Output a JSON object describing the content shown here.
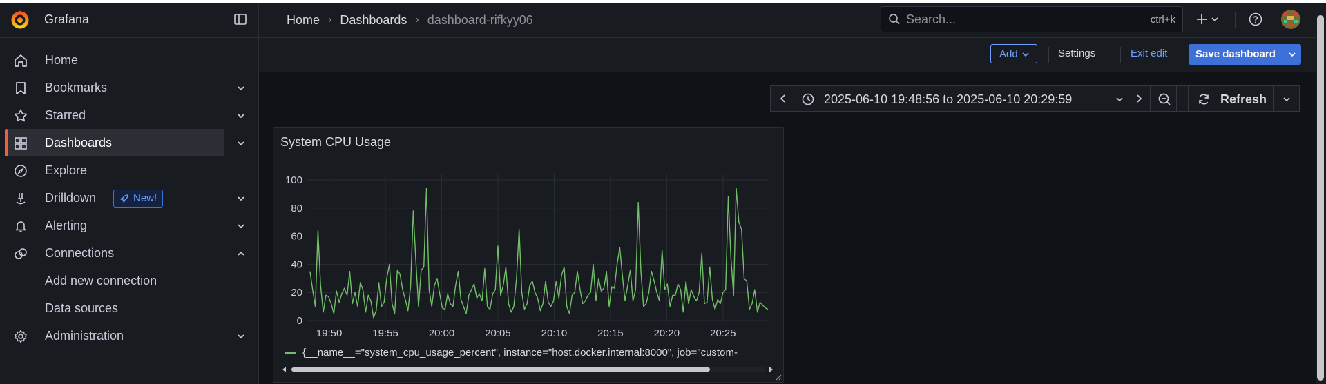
{
  "app": {
    "name": "Grafana"
  },
  "sidebar": {
    "items": [
      {
        "label": "Home",
        "icon": "home-icon",
        "chevron": ""
      },
      {
        "label": "Bookmarks",
        "icon": "bookmark-icon",
        "chevron": "down"
      },
      {
        "label": "Starred",
        "icon": "star-icon",
        "chevron": "down"
      },
      {
        "label": "Dashboards",
        "icon": "dashboards-icon",
        "chevron": "down",
        "active": true
      },
      {
        "label": "Explore",
        "icon": "compass-icon",
        "chevron": ""
      },
      {
        "label": "Drilldown",
        "icon": "drilldown-icon",
        "chevron": "down",
        "badge": "New!"
      },
      {
        "label": "Alerting",
        "icon": "bell-icon",
        "chevron": "down"
      },
      {
        "label": "Connections",
        "icon": "connections-icon",
        "chevron": "up"
      },
      {
        "label": "Add new connection",
        "sub": true
      },
      {
        "label": "Data sources",
        "sub": true
      },
      {
        "label": "Administration",
        "icon": "gear-icon",
        "chevron": "down"
      }
    ]
  },
  "header": {
    "breadcrumbs": [
      "Home",
      "Dashboards",
      "dashboard-rifkyy06"
    ],
    "search": {
      "placeholder": "Search...",
      "shortcut": "ctrl+k"
    }
  },
  "toolbar": {
    "add_label": "Add",
    "settings_label": "Settings",
    "exit_edit_label": "Exit edit",
    "save_label": "Save dashboard"
  },
  "time_picker": {
    "range": "2025-06-10 19:48:56 to 2025-06-10 20:29:59",
    "refresh_label": "Refresh"
  },
  "panel": {
    "title": "System CPU Usage",
    "legend": "{__name__=\"system_cpu_usage_percent\", instance=\"host.docker.internal:8000\", job=\"custom-"
  },
  "colors": {
    "accent": "#3d71d9",
    "series": "#73bf69",
    "brand": "#f55f3e"
  },
  "chart_data": {
    "type": "line",
    "title": "System CPU Usage",
    "xlabel": "",
    "ylabel": "",
    "x_ticks": [
      "19:50",
      "19:55",
      "20:00",
      "20:05",
      "20:10",
      "20:15",
      "20:20",
      "20:25"
    ],
    "y_ticks": [
      "0",
      "20",
      "40",
      "60",
      "80",
      "100"
    ],
    "ylim": [
      0,
      100
    ],
    "xlim_minutes_from_1948": [
      0,
      41
    ],
    "grid": true,
    "series": [
      {
        "name": "{__name__=\"system_cpu_usage_percent\", instance=\"host.docker.internal:8000\", job=\"custom-",
        "color": "#73bf69",
        "values": [
          35,
          22,
          10,
          64,
          25,
          6,
          18,
          17,
          12,
          5,
          21,
          13,
          19,
          23,
          18,
          35,
          12,
          20,
          10,
          27,
          22,
          6,
          18,
          14,
          2,
          7,
          27,
          10,
          13,
          30,
          40,
          12,
          5,
          36,
          33,
          22,
          15,
          7,
          24,
          78,
          42,
          10,
          36,
          38,
          94,
          22,
          10,
          25,
          30,
          19,
          9,
          8,
          19,
          12,
          10,
          25,
          35,
          15,
          10,
          5,
          18,
          22,
          26,
          16,
          19,
          14,
          37,
          10,
          8,
          19,
          22,
          53,
          18,
          25,
          38,
          12,
          6,
          10,
          30,
          65,
          20,
          8,
          12,
          25,
          28,
          20,
          16,
          7,
          12,
          28,
          13,
          10,
          14,
          28,
          16,
          32,
          38,
          10,
          5,
          18,
          20,
          35,
          22,
          12,
          14,
          18,
          20,
          40,
          14,
          30,
          21,
          23,
          35,
          10,
          24,
          23,
          40,
          52,
          32,
          14,
          25,
          36,
          14,
          22,
          84,
          35,
          10,
          12,
          20,
          35,
          28,
          20,
          14,
          50,
          22,
          26,
          10,
          18,
          18,
          26,
          22,
          6,
          28,
          12,
          22,
          17,
          14,
          20,
          48,
          12,
          13,
          38,
          15,
          8,
          15,
          12,
          20,
          22,
          88,
          45,
          18,
          94,
          70,
          65,
          30,
          28,
          8,
          12,
          22,
          6,
          13,
          11,
          9,
          8
        ]
      }
    ]
  }
}
